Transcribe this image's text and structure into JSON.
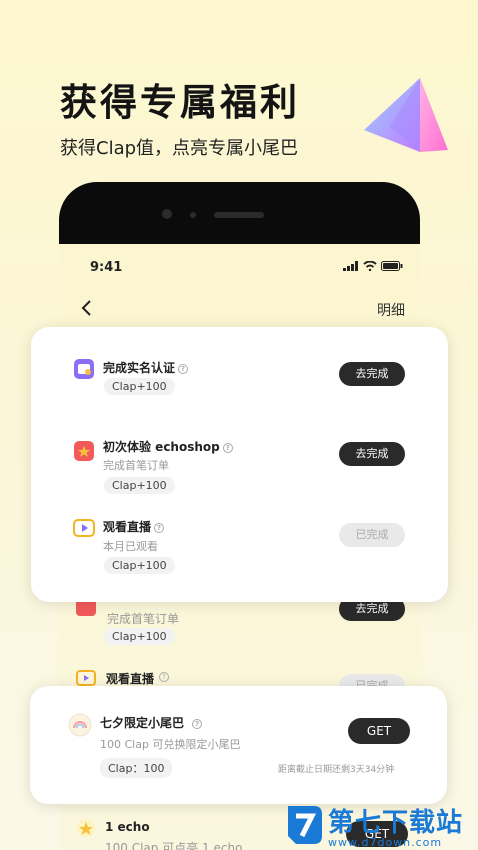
{
  "promo": {
    "headline": "获得专属福利",
    "subline": "获得Clap值，点亮专属小尾巴"
  },
  "phone": {
    "time": "9:41",
    "nav_title": "明细",
    "back_icon": "chevron-left-icon"
  },
  "tasks_card": {
    "items": [
      {
        "title": "完成实名认证",
        "desc": "",
        "reward": "Clap+100",
        "button": "去完成",
        "state": "active",
        "icon": "id-card-icon",
        "icon_color": "#8b6ef5"
      },
      {
        "title": "初次体验 echoshop",
        "desc": "完成首笔订单",
        "reward": "Clap+100",
        "button": "去完成",
        "state": "active",
        "icon": "gift-icon",
        "icon_color": "#f25a5a"
      },
      {
        "title": "观看直播",
        "desc": "本月已观看",
        "reward": "Clap+100",
        "button": "已完成",
        "state": "done",
        "icon": "live-tv-icon",
        "icon_color": "#f5b323"
      }
    ]
  },
  "background_list": {
    "item1": {
      "desc": "完成首笔订单",
      "reward": "Clap+100",
      "button": "去完成"
    },
    "item2": {
      "title": "观看直播",
      "button": "已完成"
    },
    "item3": {
      "title": "1 echo",
      "desc": "100 Clap 可点亮 1 echo",
      "button": "GET"
    }
  },
  "reward_card": {
    "title": "七夕限定小尾巴",
    "desc": "100 Clap 可兑换限定小尾巴",
    "price": "Clap：100",
    "button": "GET",
    "deadline": "距离截止日期还剩3天34分钟"
  },
  "watermark": {
    "name": "第七下载站",
    "url": "www.d7down.com"
  },
  "colors": {
    "accent_dark": "#2a2a2a",
    "watermark_blue": "#1a7ad6"
  }
}
